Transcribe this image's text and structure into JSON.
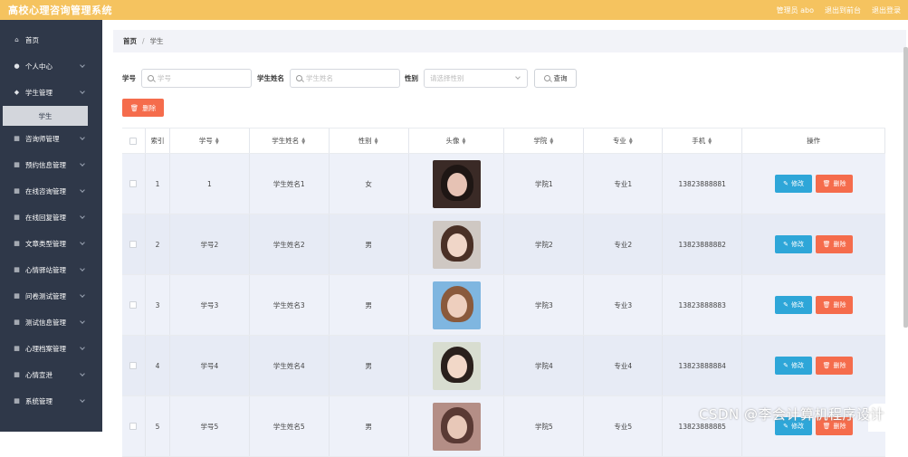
{
  "header": {
    "title": "高校心理咨询管理系统",
    "user_label": "管理员 abo",
    "back_label": "退出到前台",
    "logout_label": "退出登录"
  },
  "sidebar": {
    "items": [
      {
        "label": "首页",
        "icon": "home-icon",
        "has_chevron": false
      },
      {
        "label": "个人中心",
        "icon": "user-icon",
        "has_chevron": true
      },
      {
        "label": "学生管理",
        "icon": "location-icon",
        "has_chevron": true
      },
      {
        "label": "咨询师管理",
        "icon": "grid-icon",
        "has_chevron": true
      },
      {
        "label": "预约信息管理",
        "icon": "grid-icon",
        "has_chevron": true
      },
      {
        "label": "在线咨询管理",
        "icon": "grid-icon",
        "has_chevron": true
      },
      {
        "label": "在线回复管理",
        "icon": "grid-icon",
        "has_chevron": true
      },
      {
        "label": "文章类型管理",
        "icon": "grid-icon",
        "has_chevron": true
      },
      {
        "label": "心情驿站管理",
        "icon": "grid-icon",
        "has_chevron": true
      },
      {
        "label": "问卷测试管理",
        "icon": "grid-icon",
        "has_chevron": true
      },
      {
        "label": "测试信息管理",
        "icon": "grid-icon",
        "has_chevron": true
      },
      {
        "label": "心理档案管理",
        "icon": "grid-icon",
        "has_chevron": true
      },
      {
        "label": "心情宣泄",
        "icon": "grid-icon",
        "has_chevron": true
      },
      {
        "label": "系统管理",
        "icon": "grid-icon",
        "has_chevron": true
      }
    ],
    "active_sub": "学生"
  },
  "breadcrumb": {
    "home": "首页",
    "current": "学生"
  },
  "filters": {
    "id_label": "学号",
    "id_placeholder": "学号",
    "name_label": "学生姓名",
    "name_placeholder": "学生姓名",
    "gender_label": "性别",
    "gender_placeholder": "请选择性别",
    "search_label": "查询"
  },
  "toolbar": {
    "delete_label": "删除"
  },
  "table": {
    "headers": [
      "索引",
      "学号",
      "学生姓名",
      "性别",
      "头像",
      "学院",
      "专业",
      "手机",
      "操作"
    ],
    "edit_label": "修改",
    "remove_label": "删除",
    "rows": [
      {
        "index": "1",
        "id": "1",
        "name": "学生姓名1",
        "gender": "女",
        "college": "学院1",
        "major": "专业1",
        "phone": "13823888881",
        "avatar_bg": "#3a2a26",
        "avatar_face": "#e6c2b4",
        "avatar_hair": "#1e1614"
      },
      {
        "index": "2",
        "id": "学号2",
        "name": "学生姓名2",
        "gender": "男",
        "college": "学院2",
        "major": "专业2",
        "phone": "13823888882",
        "avatar_bg": "#cfc8c3",
        "avatar_face": "#f0d6c8",
        "avatar_hair": "#4a3026"
      },
      {
        "index": "3",
        "id": "学号3",
        "name": "学生姓名3",
        "gender": "男",
        "college": "学院3",
        "major": "专业3",
        "phone": "13823888883",
        "avatar_bg": "#7fb6e0",
        "avatar_face": "#eecfbe",
        "avatar_hair": "#8a5a3c"
      },
      {
        "index": "4",
        "id": "学号4",
        "name": "学生姓名4",
        "gender": "男",
        "college": "学院4",
        "major": "专业4",
        "phone": "13823888884",
        "avatar_bg": "#d8ddd0",
        "avatar_face": "#f2d8c8",
        "avatar_hair": "#2a201c"
      },
      {
        "index": "5",
        "id": "学号5",
        "name": "学生姓名5",
        "gender": "男",
        "college": "学院5",
        "major": "专业5",
        "phone": "13823888885",
        "avatar_bg": "#b48e86",
        "avatar_face": "#e8c8b8",
        "avatar_hair": "#5a3a34"
      }
    ]
  },
  "watermark": "CSDN @李会计算机程序设计",
  "colors": {
    "topbar": "#f5c35f",
    "sidebar": "#2f3849",
    "edit": "#2ea6d8",
    "danger": "#f56c4c"
  }
}
